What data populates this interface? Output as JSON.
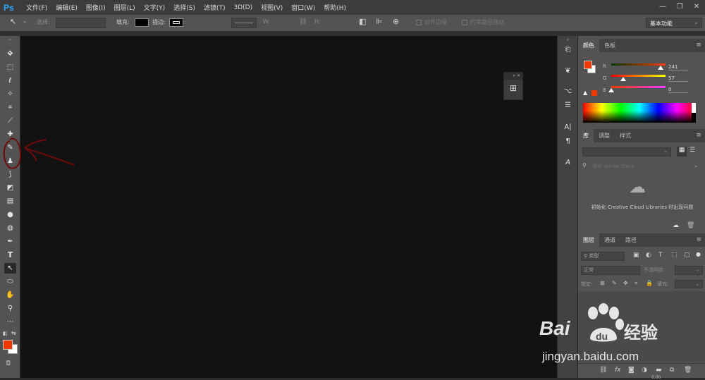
{
  "app": {
    "logo": "Ps"
  },
  "menu": [
    "文件(F)",
    "编辑(E)",
    "图像(I)",
    "图层(L)",
    "文字(Y)",
    "选择(S)",
    "滤镜(T)",
    "3D(D)",
    "视图(V)",
    "窗口(W)",
    "帮助(H)"
  ],
  "window_controls": [
    "—",
    "❐",
    "✕"
  ],
  "options_bar": {
    "select_label": "选择:",
    "fill_label": "填充:",
    "stroke_label": "描边:",
    "w_label": "W:",
    "h_label": "H:",
    "align_edges": "对齐边缘",
    "constrain_path": "约束路径拖动",
    "workspace": "基本功能"
  },
  "color_panel": {
    "tabs": [
      "颜色",
      "色板"
    ],
    "r_label": "R",
    "g_label": "G",
    "b_label": "B",
    "r": "241",
    "g": "57",
    "b": "0"
  },
  "library_panel": {
    "tabs": [
      "库",
      "调整",
      "样式"
    ],
    "search_placeholder": "搜索 Adobe Stock",
    "message": "初始化 Creative Cloud Libraries 时出现问题"
  },
  "layers_panel": {
    "tabs": [
      "图层",
      "通道",
      "路径"
    ],
    "kind_label": "类型",
    "blend_mode": "正常",
    "opacity_label": "不透明度:",
    "lock_label": "锁定:",
    "fill_label": "填充:",
    "bottom_icons": [
      "fx"
    ]
  },
  "colors": {
    "foreground": "#f13900",
    "background": "#ffffff"
  },
  "watermark": {
    "brand": "Bai",
    "brand_cn": "经验",
    "url": "jingyan.baidu.com"
  },
  "status": {
    "bottom_right": "0.00"
  }
}
